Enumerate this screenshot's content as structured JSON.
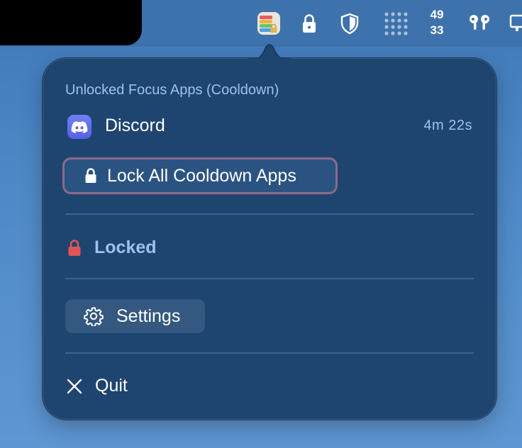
{
  "menubar": {
    "stats": {
      "top": "49",
      "bottom": "33"
    },
    "icons": [
      "focus-app-icon",
      "lock-icon",
      "shield-icon",
      "grid-dots-icon",
      "stats-widget",
      "airpods-icon",
      "display-icon"
    ]
  },
  "popover": {
    "section_title": "Unlocked Focus Apps (Cooldown)",
    "apps": [
      {
        "name": "Discord",
        "time_remaining": "4m 22s",
        "icon": "discord-icon"
      }
    ],
    "lock_all_label": "Lock All Cooldown Apps",
    "status_label": "Locked",
    "settings_label": "Settings",
    "quit_label": "Quit"
  },
  "colors": {
    "popover_bg": "#1e4470",
    "accent_text": "#9ec2ea",
    "focus_ring": "#8d6a8a",
    "locked_red": "#e05555",
    "discord": "#5865f2"
  }
}
